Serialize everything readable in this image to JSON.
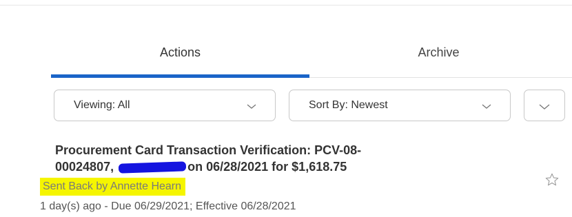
{
  "tabs": [
    {
      "label": "Actions",
      "active": true
    },
    {
      "label": "Archive",
      "active": false
    }
  ],
  "filters": {
    "viewing_label": "Viewing: All",
    "sort_label": "Sort By: Newest"
  },
  "item": {
    "title_line1": "Procurement Card Transaction Verification: PCV-08-",
    "title_line2_prefix": "00024807, ",
    "title_line2_suffix": "on 06/28/2021 for $1,618.75",
    "status": "Sent Back by Annette Hearn",
    "meta": "1 day(s) ago - Due 06/29/2021; Effective 06/28/2021"
  },
  "colors": {
    "accent": "#1a64c8",
    "highlight": "#f5f500",
    "redaction": "#1414e0"
  },
  "icons": {
    "dropdown": "chevron-down-icon",
    "favorite": "star-outline-icon"
  }
}
